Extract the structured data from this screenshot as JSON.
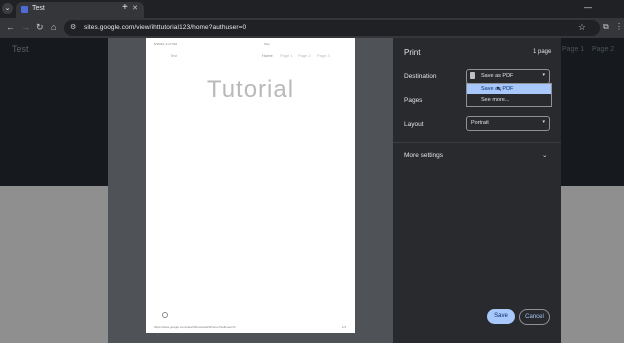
{
  "browser": {
    "tab_title": "Test",
    "url": "sites.google.com/view/ihttutorial123/home?authuser=0",
    "tab_menu_icon": "chevron-down-icon",
    "new_tab_icon": "plus-icon"
  },
  "background_page": {
    "site_title": "Test",
    "nav_items": [
      "Page 1",
      "Page 2"
    ]
  },
  "preview": {
    "header_left": "6/16/24, 4:17 PM",
    "header_center": "Test",
    "site_name": "Test",
    "nav": [
      "Home",
      "Page 1",
      "Page 2",
      "Page 3"
    ],
    "heading": "Tutorial",
    "footer_url": "https://sites.google.com/view/ihttutorial123/home?authuser=0",
    "footer_page": "1/1"
  },
  "print_dialog": {
    "title": "Print",
    "page_count": "1 page",
    "destination_label": "Destination",
    "destination_value": "Save as PDF",
    "destination_options": [
      "Save as PDF",
      "See more..."
    ],
    "pages_label": "Pages",
    "layout_label": "Layout",
    "layout_value": "Portrait",
    "more_settings_label": "More settings",
    "save_label": "Save",
    "cancel_label": "Cancel"
  }
}
